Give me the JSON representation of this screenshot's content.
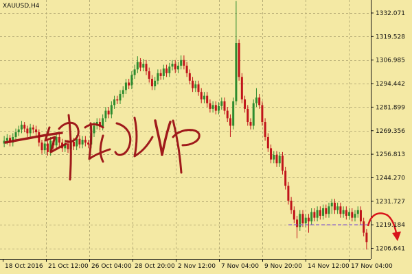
{
  "chart_data": {
    "type": "candlestick",
    "title": "XAUUSD,H4",
    "y_tick_labels": [
      "1332.071",
      "1319.528",
      "1306.985",
      "1294.442",
      "1281.899",
      "1269.356",
      "1256.813",
      "1244.270",
      "1231.727",
      "1219.184",
      "1206.641"
    ],
    "y_ticks": [
      1332.071,
      1319.528,
      1306.985,
      1294.442,
      1281.899,
      1269.356,
      1256.813,
      1244.27,
      1231.727,
      1219.184,
      1206.641
    ],
    "ylim": [
      1201.0,
      1339.0
    ],
    "x_tick_labels": [
      "18 Oct 2016",
      "21 Oct 12:00",
      "26 Oct 04:00",
      "28 Oct 20:00",
      "2 Nov 12:00",
      "7 Nov 04:00",
      "9 Nov 20:00",
      "14 Nov 12:00",
      "17 Nov 04:00"
    ],
    "reference_line": 1219.184,
    "grid": true,
    "colors": {
      "up": "#2e8b2e",
      "down": "#c0141a",
      "background": "#f4e9a4",
      "grid": "#b7ad77",
      "reference": "#8a63c9",
      "arrow": "#d8141a"
    },
    "closes": [
      1264.0,
      1265.5,
      1263.0,
      1266.0,
      1268.5,
      1270.0,
      1272.5,
      1270.5,
      1268.0,
      1271.0,
      1270.0,
      1268.5,
      1263.0,
      1259.0,
      1262.5,
      1258.0,
      1264.0,
      1261.5,
      1266.0,
      1263.0,
      1260.0,
      1262.5,
      1259.5,
      1263.5,
      1261.0,
      1265.0,
      1262.0,
      1264.5,
      1263.0,
      1262.0,
      1268.0,
      1272.0,
      1274.0,
      1271.5,
      1276.0,
      1280.0,
      1278.0,
      1283.0,
      1286.0,
      1285.5,
      1289.0,
      1291.0,
      1295.0,
      1293.5,
      1299.0,
      1302.0,
      1306.0,
      1303.0,
      1305.0,
      1301.0,
      1297.0,
      1293.0,
      1296.0,
      1300.0,
      1298.5,
      1302.5,
      1300.0,
      1303.5,
      1305.0,
      1302.0,
      1304.0,
      1307.0,
      1304.0,
      1300.0,
      1296.0,
      1292.0,
      1294.0,
      1290.0,
      1286.0,
      1288.0,
      1284.0,
      1281.0,
      1283.0,
      1280.0,
      1282.5,
      1285.0,
      1280.0,
      1276.0,
      1272.0,
      1285.0,
      1316.0,
      1298.0,
      1286.0,
      1281.0,
      1274.0,
      1272.0,
      1284.0,
      1287.0,
      1283.0,
      1274.0,
      1266.0,
      1260.0,
      1254.0,
      1256.5,
      1252.0,
      1256.0,
      1248.0,
      1240.0,
      1232.0,
      1227.0,
      1222.0,
      1218.0,
      1225.0,
      1220.0,
      1223.0,
      1221.0,
      1226.0,
      1223.0,
      1227.0,
      1224.0,
      1228.0,
      1225.0,
      1229.0,
      1231.0,
      1227.0,
      1229.0,
      1225.0,
      1227.0,
      1224.0,
      1226.0,
      1223.0,
      1225.0,
      1227.0,
      1221.0,
      1215.0,
      1210.0
    ],
    "opens": [
      1262.5,
      1264.0,
      1265.5,
      1263.0,
      1266.0,
      1268.5,
      1270.0,
      1272.5,
      1270.5,
      1268.0,
      1271.0,
      1270.0,
      1268.5,
      1263.0,
      1259.0,
      1262.5,
      1258.0,
      1264.0,
      1261.5,
      1266.0,
      1263.0,
      1260.0,
      1262.5,
      1259.5,
      1263.5,
      1261.0,
      1265.0,
      1262.0,
      1264.5,
      1263.0,
      1262.0,
      1268.0,
      1272.0,
      1274.0,
      1271.5,
      1276.0,
      1280.0,
      1278.0,
      1283.0,
      1286.0,
      1285.5,
      1289.0,
      1291.0,
      1295.0,
      1293.5,
      1299.0,
      1302.0,
      1306.0,
      1303.0,
      1305.0,
      1301.0,
      1297.0,
      1293.0,
      1296.0,
      1300.0,
      1298.5,
      1302.5,
      1300.0,
      1303.5,
      1305.0,
      1302.0,
      1304.0,
      1307.0,
      1304.0,
      1300.0,
      1296.0,
      1292.0,
      1294.0,
      1290.0,
      1286.0,
      1288.0,
      1284.0,
      1281.0,
      1283.0,
      1280.0,
      1282.5,
      1285.0,
      1280.0,
      1276.0,
      1272.0,
      1285.0,
      1316.0,
      1298.0,
      1286.0,
      1281.0,
      1274.0,
      1272.0,
      1284.0,
      1287.0,
      1283.0,
      1274.0,
      1266.0,
      1260.0,
      1254.0,
      1256.5,
      1252.0,
      1256.0,
      1248.0,
      1240.0,
      1232.0,
      1227.0,
      1222.0,
      1218.0,
      1225.0,
      1220.0,
      1223.0,
      1221.0,
      1226.0,
      1223.0,
      1227.0,
      1224.0,
      1228.0,
      1225.0,
      1229.0,
      1231.0,
      1227.0,
      1229.0,
      1225.0,
      1227.0,
      1224.0,
      1226.0,
      1223.0,
      1225.0,
      1227.0,
      1221.0,
      1215.0
    ],
    "highs": [
      1266.5,
      1267.5,
      1267.0,
      1268.0,
      1270.5,
      1272.0,
      1274.5,
      1274.0,
      1272.0,
      1273.0,
      1272.5,
      1272.0,
      1270.0,
      1264.5,
      1264.0,
      1264.0,
      1266.0,
      1266.0,
      1268.0,
      1268.0,
      1265.0,
      1264.5,
      1264.5,
      1265.5,
      1265.5,
      1267.0,
      1267.0,
      1266.5,
      1266.5,
      1264.5,
      1270.0,
      1274.0,
      1276.0,
      1276.0,
      1278.0,
      1282.0,
      1282.0,
      1285.0,
      1288.0,
      1288.0,
      1291.0,
      1293.0,
      1297.0,
      1297.0,
      1301.0,
      1304.5,
      1309.0,
      1308.0,
      1307.5,
      1307.0,
      1303.0,
      1299.0,
      1298.0,
      1302.0,
      1302.0,
      1304.5,
      1304.5,
      1305.5,
      1307.0,
      1307.0,
      1306.0,
      1309.5,
      1309.5,
      1306.0,
      1302.0,
      1298.0,
      1296.0,
      1296.0,
      1292.0,
      1290.0,
      1290.0,
      1286.0,
      1285.0,
      1285.0,
      1284.5,
      1287.0,
      1287.0,
      1282.0,
      1278.0,
      1287.0,
      1338.5,
      1318.0,
      1300.0,
      1288.0,
      1283.0,
      1276.0,
      1286.0,
      1292.0,
      1289.0,
      1285.0,
      1276.0,
      1268.0,
      1262.0,
      1258.5,
      1258.5,
      1258.0,
      1258.0,
      1250.0,
      1242.0,
      1234.0,
      1229.0,
      1224.0,
      1227.0,
      1227.0,
      1225.0,
      1225.0,
      1228.0,
      1228.0,
      1229.0,
      1229.0,
      1230.0,
      1230.0,
      1231.0,
      1233.0,
      1233.0,
      1231.0,
      1231.0,
      1229.0,
      1229.0,
      1228.0,
      1228.0,
      1227.0,
      1229.0,
      1229.0,
      1223.0,
      1217.0
    ],
    "lows": [
      1260.5,
      1262.0,
      1261.0,
      1261.0,
      1264.0,
      1266.5,
      1268.0,
      1268.5,
      1266.0,
      1266.0,
      1268.0,
      1266.5,
      1261.0,
      1257.0,
      1257.0,
      1256.0,
      1256.0,
      1259.5,
      1259.5,
      1261.0,
      1258.0,
      1258.0,
      1257.5,
      1257.5,
      1259.0,
      1259.0,
      1260.0,
      1260.0,
      1261.0,
      1260.0,
      1260.0,
      1266.0,
      1270.0,
      1269.5,
      1269.5,
      1274.0,
      1276.0,
      1276.0,
      1281.0,
      1283.5,
      1283.5,
      1287.0,
      1289.0,
      1291.5,
      1291.5,
      1297.0,
      1300.0,
      1301.0,
      1301.0,
      1299.0,
      1295.0,
      1291.0,
      1291.0,
      1294.0,
      1296.5,
      1296.5,
      1298.0,
      1298.0,
      1301.5,
      1300.0,
      1300.0,
      1302.0,
      1302.0,
      1298.0,
      1294.0,
      1290.0,
      1290.0,
      1288.0,
      1284.0,
      1284.0,
      1282.0,
      1279.0,
      1279.0,
      1278.0,
      1278.0,
      1280.5,
      1278.0,
      1274.0,
      1266.0,
      1270.0,
      1283.0,
      1296.0,
      1284.0,
      1279.0,
      1272.0,
      1270.0,
      1270.0,
      1282.0,
      1281.0,
      1272.0,
      1264.0,
      1258.0,
      1252.0,
      1252.0,
      1250.0,
      1250.0,
      1246.0,
      1238.0,
      1230.0,
      1225.0,
      1220.0,
      1212.0,
      1216.0,
      1218.0,
      1218.0,
      1215.0,
      1219.0,
      1221.0,
      1221.0,
      1222.0,
      1222.0,
      1223.0,
      1223.0,
      1225.0,
      1225.0,
      1225.0,
      1223.0,
      1223.0,
      1222.0,
      1222.0,
      1221.0,
      1221.0,
      1223.0,
      1219.0,
      1213.0,
      1206.0
    ]
  }
}
